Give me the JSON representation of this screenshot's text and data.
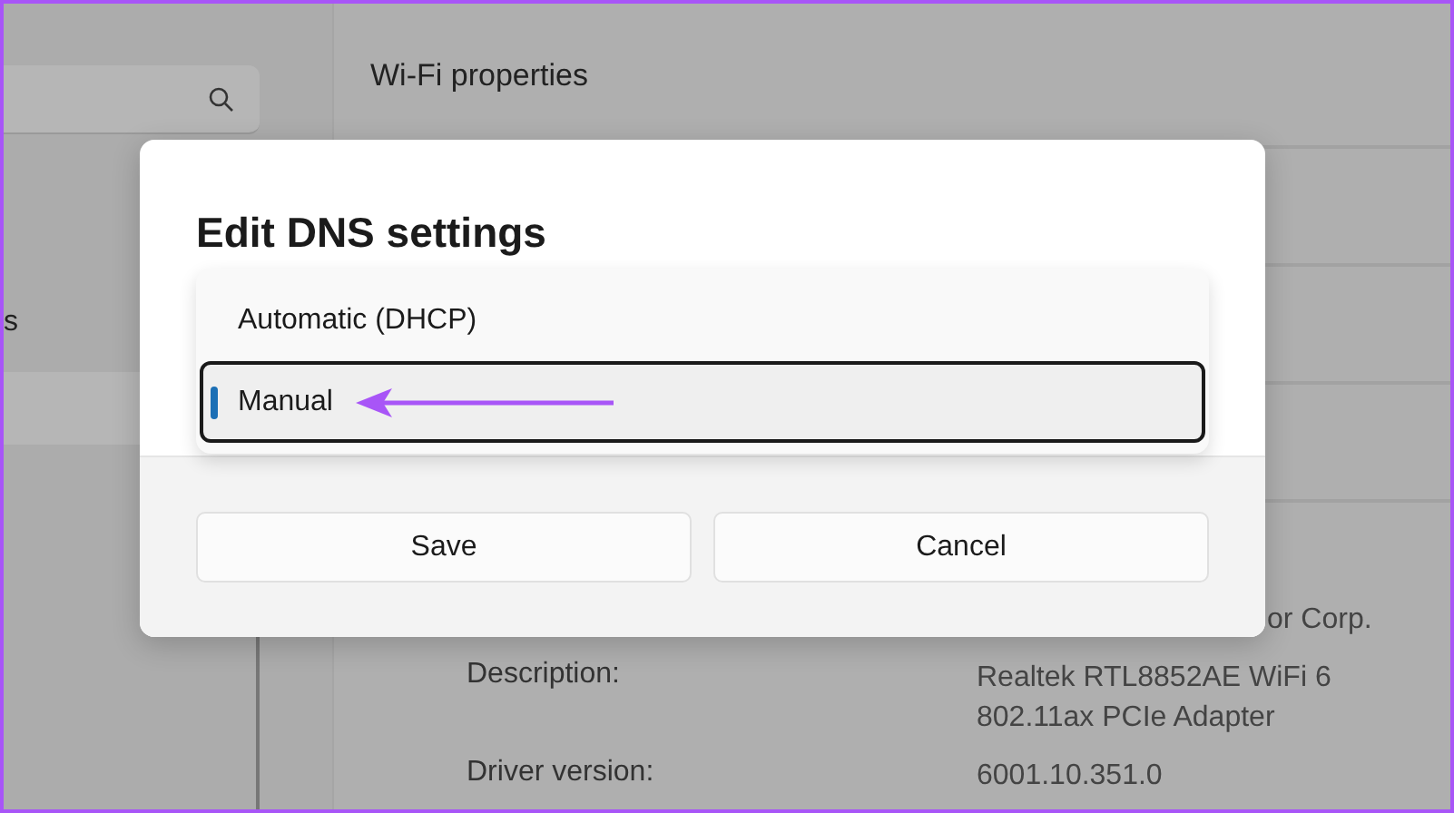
{
  "sidebar": {
    "items": [
      {
        "label": "s",
        "selected": false
      },
      {
        "selected": true
      }
    ]
  },
  "settings_page": {
    "heading": "Wi-Fi properties",
    "properties": [
      {
        "value": "or Corp."
      },
      {
        "label": "Description:",
        "value": "Realtek RTL8852AE WiFi 6 802.11ax PCIe Adapter"
      },
      {
        "label": "Driver version:",
        "value": "6001.10.351.0"
      }
    ]
  },
  "dialog": {
    "title": "Edit DNS settings",
    "options": [
      {
        "label": "Automatic (DHCP)",
        "selected": false
      },
      {
        "label": "Manual",
        "selected": true
      }
    ],
    "buttons": [
      "Save",
      "Cancel"
    ]
  }
}
